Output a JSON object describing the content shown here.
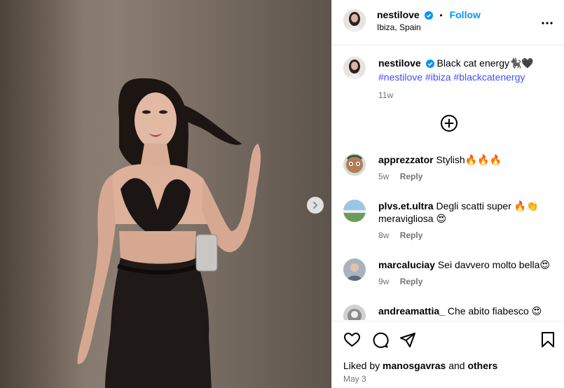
{
  "post": {
    "username": "nestilove",
    "location": "Ibiza, Spain",
    "follow_label": "Follow",
    "dot": "•"
  },
  "caption": {
    "username": "nestilove",
    "text": "Black cat energy🐈‍⬛🖤",
    "hashtags": [
      "#nestilove",
      "#ibiza",
      "#blackcatenergy"
    ],
    "time": "11w"
  },
  "comments": [
    {
      "username": "apprezzator",
      "text": "Stylish🔥🔥🔥",
      "time": "5w",
      "reply": "Reply"
    },
    {
      "username": "plvs.et.ultra",
      "text": "Degli scatti super 🔥👏 meravigliosa 😍",
      "time": "8w",
      "reply": "Reply"
    },
    {
      "username": "marcaluciay",
      "text": "Sei davvero molto bella😍",
      "time": "9w",
      "reply": "Reply"
    },
    {
      "username": "andreamattia_",
      "text": "Che abito fiabesco 😍",
      "time": "",
      "reply": ""
    }
  ],
  "footer": {
    "liked_by_prefix": "Liked by",
    "liked_by_user": "manosgavras",
    "and": "and",
    "others": "others",
    "date": "May 3"
  },
  "colors": {
    "accent": "#0095f6",
    "hashtag": "#4150f7",
    "muted": "#737373",
    "border": "#efefef"
  },
  "icons": [
    "verified-badge-icon",
    "more-options-icon",
    "add-circle-icon",
    "heart-icon",
    "comment-icon",
    "share-icon",
    "bookmark-icon",
    "chevron-right-icon"
  ]
}
